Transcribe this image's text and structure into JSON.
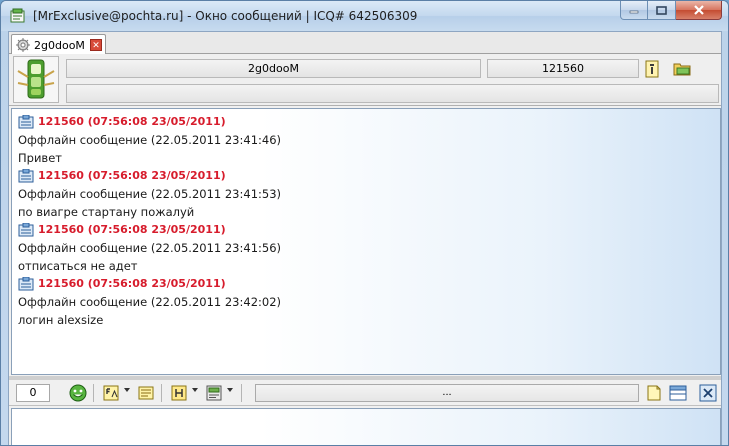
{
  "window": {
    "title": "[MrExclusive@pochta.ru] - Окно сообщений | ICQ# 642506309"
  },
  "tabs": [
    {
      "label": "2g0dooM"
    }
  ],
  "contact": {
    "nick": "2g0dooM",
    "uin": "121560",
    "status_text": ""
  },
  "messages": [
    {
      "author": "121560 (07:56:08 23/05/2011)",
      "line1": "Оффлайн сообщение (22.05.2011 23:41:46)",
      "line2": "Привет"
    },
    {
      "author": "121560 (07:56:08 23/05/2011)",
      "line1": "Оффлайн сообщение (22.05.2011 23:41:53)",
      "line2": "по виагре стартану пожалуй"
    },
    {
      "author": "121560 (07:56:08 23/05/2011)",
      "line1": "Оффлайн сообщение (22.05.2011 23:41:56)",
      "line2": "отписаться не адет"
    },
    {
      "author": "121560 (07:56:08 23/05/2011)",
      "line1": "Оффлайн сообщение (22.05.2011 23:42:02)",
      "line2": "логин alexsize"
    }
  ],
  "input": {
    "char_count": "0",
    "status_field": "...",
    "text": ""
  },
  "colors": {
    "author": "#d71c2c",
    "history_bg_end": "#cfe2f5",
    "titlebar": "#c3d8ee",
    "close_button": "#c44c32"
  },
  "icons": {
    "title": "chat-window-icon",
    "tab": "gear-status-icon",
    "avatar": "traffic-light-avatar-icon",
    "info": "user-info-icon",
    "history": "folder-history-icon",
    "message": "incoming-message-icon",
    "smile": "smile-icon",
    "font": "font-icon",
    "template": "template-icon",
    "format": "text-format-icon",
    "send_mode": "send-mode-icon",
    "new_note": "note-icon",
    "layout": "layout-icon",
    "close_tab": "close-icon"
  }
}
